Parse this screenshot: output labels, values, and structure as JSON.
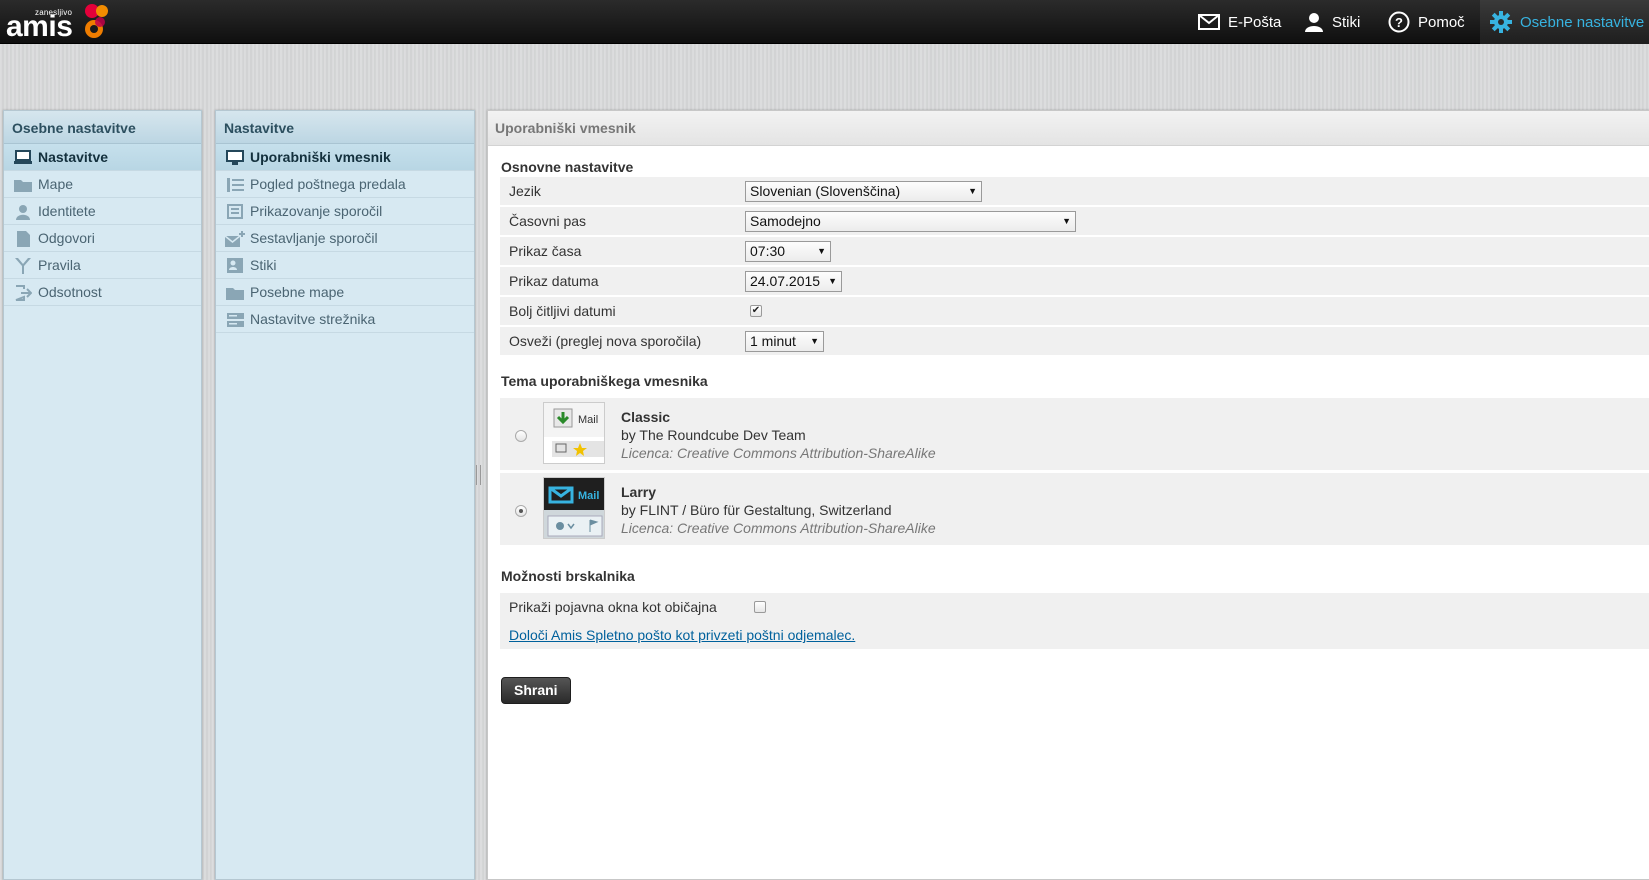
{
  "logo": {
    "tagline": "zanesljivo",
    "wordmark": "amis"
  },
  "topnav": {
    "mail": {
      "label": "E-Pošta",
      "icon": "envelope-icon"
    },
    "contacts": {
      "label": "Stiki",
      "icon": "person-icon"
    },
    "help": {
      "label": "Pomoč",
      "icon": "question-icon"
    },
    "settings": {
      "label": "Osebne nastavitve",
      "icon": "gear-icon"
    }
  },
  "colors": {
    "accent": "#37b3e0",
    "link": "#00619c",
    "panel_bg": "#d7e9f2"
  },
  "sections_panel": {
    "title": "Osebne nastavitve",
    "items": [
      {
        "label": "Nastavitve",
        "icon": "monitor-icon",
        "selected": true
      },
      {
        "label": "Mape",
        "icon": "folder-icon"
      },
      {
        "label": "Identitete",
        "icon": "user-icon"
      },
      {
        "label": "Odgovori",
        "icon": "document-icon"
      },
      {
        "label": "Pravila",
        "icon": "filter-icon"
      },
      {
        "label": "Odsotnost",
        "icon": "exit-icon"
      }
    ]
  },
  "settings_panel": {
    "title": "Nastavitve",
    "items": [
      {
        "label": "Uporabniški vmesnik",
        "icon": "monitor-icon",
        "selected": true
      },
      {
        "label": "Pogled poštnega predala",
        "icon": "list-icon"
      },
      {
        "label": "Prikazovanje sporočil",
        "icon": "message-view-icon"
      },
      {
        "label": "Sestavljanje sporočil",
        "icon": "compose-icon"
      },
      {
        "label": "Stiki",
        "icon": "contact-card-icon"
      },
      {
        "label": "Posebne mape",
        "icon": "folder-icon"
      },
      {
        "label": "Nastavitve strežnika",
        "icon": "server-icon"
      }
    ]
  },
  "main": {
    "title": "Uporabniški vmesnik",
    "basic": {
      "title": "Osnovne nastavitve",
      "language": {
        "label": "Jezik",
        "value": "Slovenian (Slovenščina)"
      },
      "timezone": {
        "label": "Časovni pas",
        "value": "Samodejno"
      },
      "time_format": {
        "label": "Prikaz časa",
        "value": "07:30"
      },
      "date_format": {
        "label": "Prikaz datuma",
        "value": "24.07.2015"
      },
      "pretty_dates": {
        "label": "Bolj čitljivi datumi",
        "checked": true
      },
      "refresh": {
        "label": "Osveži (preglej nova sporočila)",
        "value": "1 minut"
      }
    },
    "skin": {
      "title": "Tema uporabniškega vmesnika",
      "options": [
        {
          "name": "Classic",
          "author": "by The Roundcube Dev Team",
          "license": "Licenca: Creative Commons Attribution-ShareAlike",
          "thumb_label": "Mail",
          "selected": false
        },
        {
          "name": "Larry",
          "author": "by FLINT / Büro für Gestaltung, Switzerland",
          "license": "Licenca: Creative Commons Attribution-ShareAlike",
          "thumb_label": "Mail",
          "selected": true
        }
      ]
    },
    "browser": {
      "title": "Možnosti brskalnika",
      "popups": {
        "label": "Prikaži pojavna okna kot običajna",
        "checked": false
      },
      "default_link": "Določi Amis Spletno pošto kot privzeti poštni odjemalec."
    },
    "save_label": "Shrani"
  }
}
